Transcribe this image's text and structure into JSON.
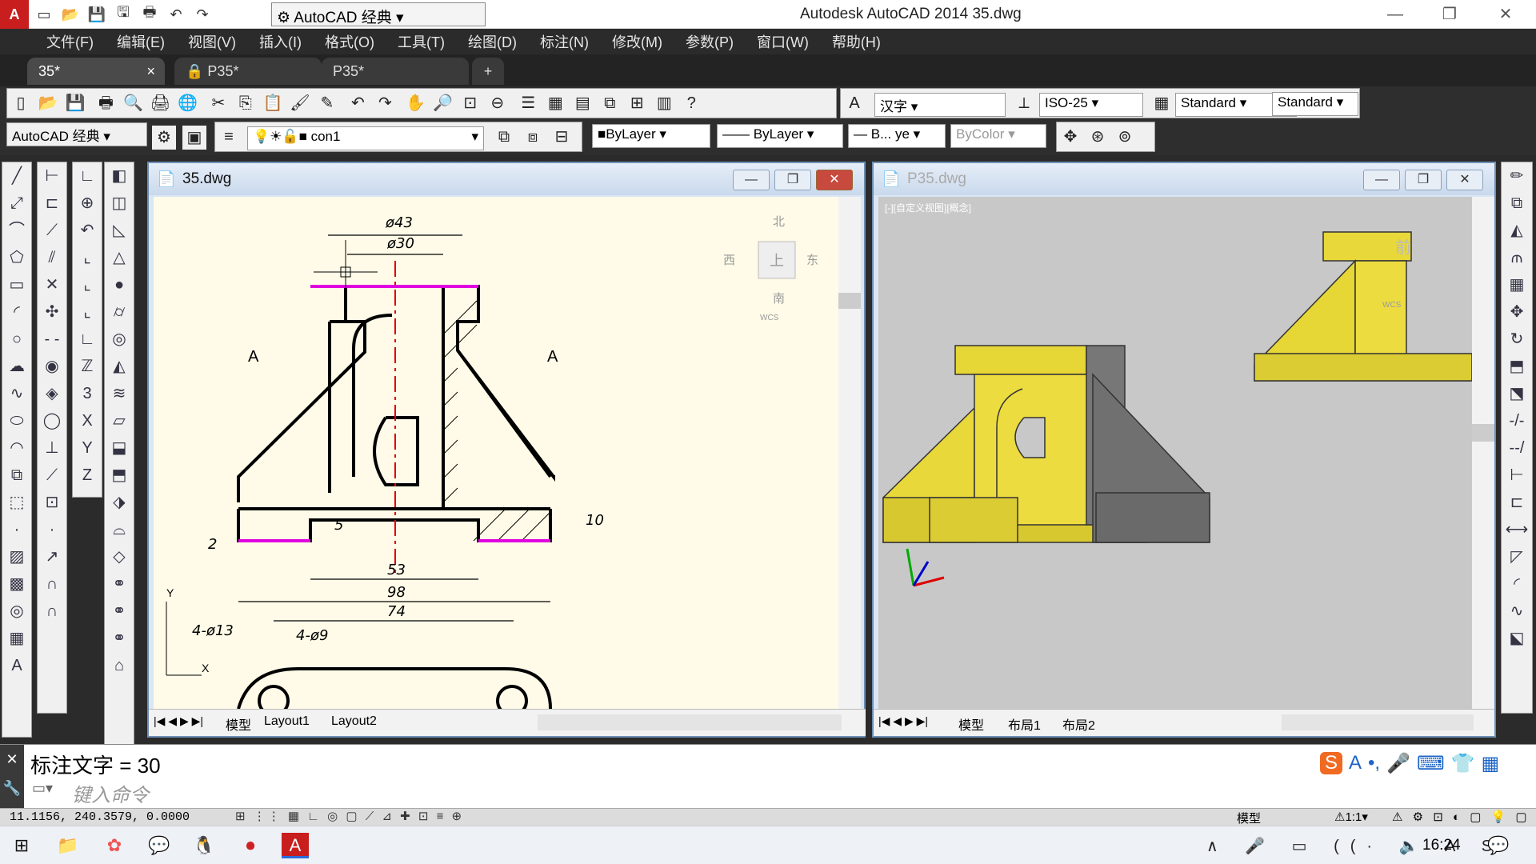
{
  "app": {
    "title": "Autodesk AutoCAD 2014    35.dwg"
  },
  "quickaccess": {
    "workspace": "AutoCAD 经典"
  },
  "menu": [
    "文件(F)",
    "编辑(E)",
    "视图(V)",
    "插入(I)",
    "格式(O)",
    "工具(T)",
    "绘图(D)",
    "标注(N)",
    "修改(M)",
    "参数(P)",
    "窗口(W)",
    "帮助(H)"
  ],
  "file_tabs": [
    "35*",
    "P35*",
    "P35*"
  ],
  "toolbar": {
    "text_style": "汉字",
    "dim_style": "ISO-25",
    "table_style": "Standard",
    "mleader_style": "Standard",
    "workspace2": "AutoCAD 经典",
    "layer": "con1",
    "color": "ByLayer",
    "linetype": "ByLayer",
    "lineweight": "B... ye",
    "plotstyle": "ByColor"
  },
  "win_left": {
    "title": "35.dwg",
    "viewcube": {
      "north": "北",
      "west": "西",
      "east": "东",
      "south": "南",
      "face": "上",
      "wcs": "WCS"
    },
    "section_label": "A",
    "dims": {
      "d43": "ø43",
      "d30": "ø30",
      "d53": "53",
      "d98": "98",
      "d74": "74",
      "d5": "5",
      "d10": "10",
      "d2": "2",
      "h413": "4-ø13",
      "h49": "4-ø9"
    },
    "ucs": {
      "y": "Y",
      "x": "X"
    },
    "layout_tabs": [
      "模型",
      "Layout1",
      "Layout2"
    ]
  },
  "win_right": {
    "title": "P35.dwg",
    "view_label": "[-][自定义视图][概念]",
    "viewcube_face": "前",
    "wcs": "WCS",
    "layout_tabs": [
      "模型",
      "布局1",
      "布局2"
    ]
  },
  "command": {
    "history": "标注文字  =  30",
    "prompt": "键入命令"
  },
  "status": {
    "coords": "11.1156,  240.3579,  0.0000",
    "model": "模型",
    "scale": "1:1"
  },
  "taskbar": {
    "time": "16:24"
  },
  "ime": {
    "label": "A"
  }
}
